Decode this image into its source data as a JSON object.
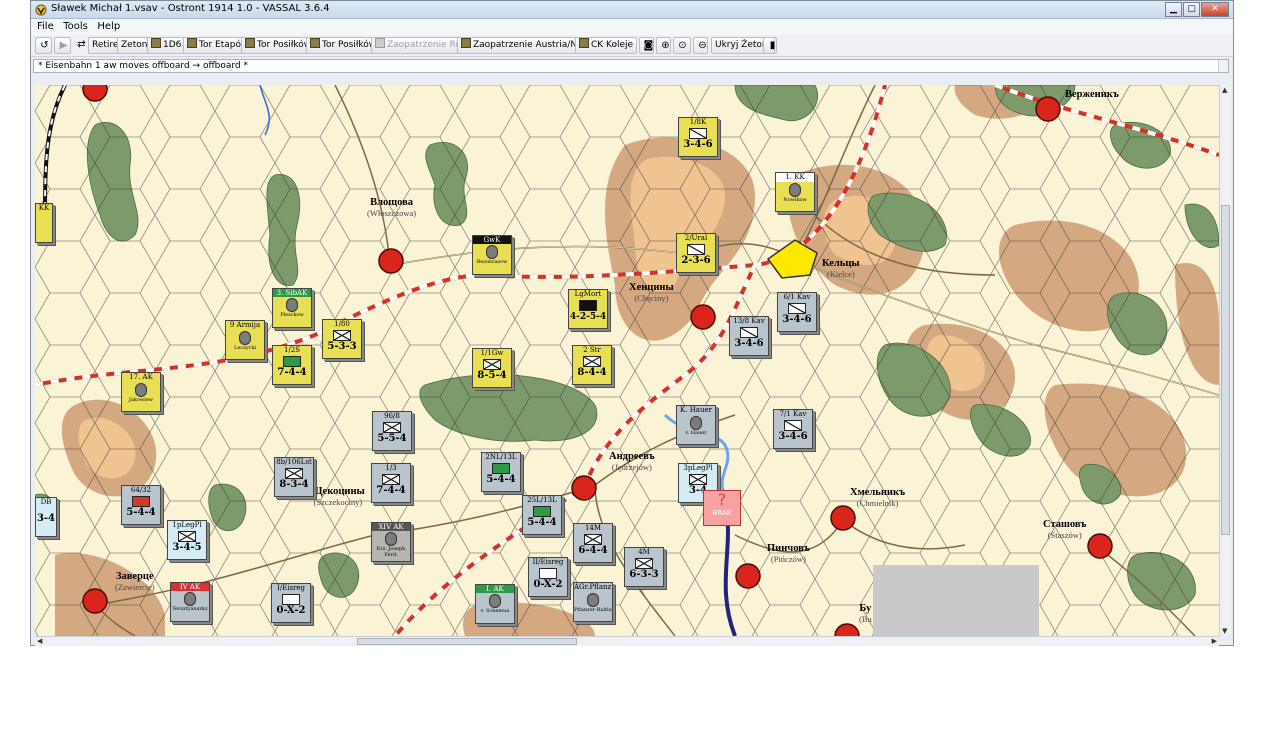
{
  "window": {
    "title": "Sławek Michał 1.vsav - Ostront 1914 1.0 - VASSAL 3.6.4",
    "controls": [
      "minimize-icon",
      "maximize-icon",
      "close-icon"
    ]
  },
  "menu": {
    "file": "File",
    "tools": "Tools",
    "help": "Help"
  },
  "toolbar": {
    "retire": "Retire",
    "zetony": "Zetony",
    "d6": "1D6",
    "tor_etapow": "Tor Etapów",
    "tor_posilkow_1": "Tor Posiłków",
    "tor_posilkow_2": "Tor Posiłków",
    "zaopatrzenie_rosja": "Zaopatrzenie Rosja",
    "zaopatrzenie_austria": "Zaopatrzenie Austria/Niemcy",
    "ck_koleje": "CK Koleje",
    "ukryj_zetony": "Ukryj Żetony"
  },
  "chat": {
    "line": "* Eisenbahn 1 aw moves offboard → offboard *"
  },
  "map": {
    "cities": [
      {
        "ru": "Влощова",
        "pl": "(Włoszczowa)"
      },
      {
        "ru": "Хенцины",
        "pl": "(Chęciny)"
      },
      {
        "ru": "Кельцы",
        "pl": "(Kielce)"
      },
      {
        "ru": "Верженикъ",
        "pl": ""
      },
      {
        "ru": "Андреевъ",
        "pl": "(Jędrzejów)"
      },
      {
        "ru": "Хмельникъ",
        "pl": "(Chmielnik)"
      },
      {
        "ru": "Сташовъ",
        "pl": "(Staszów)"
      },
      {
        "ru": "Пинчовъ",
        "pl": "(Pińczów)"
      },
      {
        "ru": "Заверце",
        "pl": "(Zawiercie)"
      },
      {
        "ru": "Щекоцины",
        "pl": "(Szczekociny)"
      },
      {
        "ru": "Бу",
        "pl": "(Bu"
      }
    ],
    "counters": [
      {
        "top": "1/8K",
        "val": "3-4-6",
        "color": "yellow",
        "sym": "cav"
      },
      {
        "top": "1. KK",
        "val": "Nowikow",
        "color": "yellow",
        "sym": "leader"
      },
      {
        "top": "GwK",
        "val": "Bezobrazow",
        "color": "yellow",
        "sym": "leader"
      },
      {
        "top": "2/Ural",
        "val": "2-3-6",
        "color": "yellow",
        "sym": "cav"
      },
      {
        "top": "LgMort",
        "val": "4-2-5-4",
        "color": "yellow",
        "sym": "art"
      },
      {
        "top": "6/1 Kav",
        "val": "3-4-6",
        "color": "grey",
        "sym": "cav"
      },
      {
        "top": "13/8 Kav",
        "val": "3-4-6",
        "color": "grey",
        "sym": "cav"
      },
      {
        "top": "1/1Gw",
        "val": "8-5-4",
        "color": "yellow",
        "sym": "inf"
      },
      {
        "top": "2 Str",
        "val": "8-4-4",
        "color": "yellow",
        "sym": "inf"
      },
      {
        "top": "K. Hauer",
        "val": "v. Hauer",
        "color": "grey",
        "sym": "leader"
      },
      {
        "top": "7/1 Kav",
        "val": "3-4-6",
        "color": "grey",
        "sym": "cav"
      },
      {
        "top": "9 Armija",
        "val": "Leczycki",
        "color": "yellow",
        "sym": "leader"
      },
      {
        "top": "1/80",
        "val": "5-3-3",
        "color": "yellow",
        "sym": "inf"
      },
      {
        "top": "1/2S",
        "val": "7-4-4",
        "color": "yellow",
        "sym": "inf"
      },
      {
        "top": "17. AK",
        "val": "Jakowlew",
        "color": "yellow",
        "sym": "leader"
      },
      {
        "top": "3. SibAK",
        "val": "Plesckow",
        "color": "yellow",
        "sym": "leader"
      },
      {
        "top": "96/8",
        "val": "5-5-4",
        "color": "grey",
        "sym": "inf"
      },
      {
        "top": "2NL/13L",
        "val": "5-4-4",
        "color": "grey",
        "sym": "inf"
      },
      {
        "top": "3pLegPl",
        "val": "3-4",
        "color": "blue",
        "sym": "inf"
      },
      {
        "top": "8b/106Lst",
        "val": "8-3-4",
        "color": "grey",
        "sym": "inf"
      },
      {
        "top": "1/3",
        "val": "7-4-4",
        "color": "grey",
        "sym": "inf"
      },
      {
        "top": "25L/13L",
        "val": "5-4-4",
        "color": "grey",
        "sym": "inf"
      },
      {
        "top": "64/32",
        "val": "5-4-4",
        "color": "grey",
        "sym": "inf"
      },
      {
        "top": "1pLegPl",
        "val": "3-4-5",
        "color": "blue",
        "sym": "inf"
      },
      {
        "top": "XIV AK",
        "val": "Erz. Joseph Ferd.",
        "color": "dgrey",
        "sym": "leader"
      },
      {
        "top": "14M",
        "val": "6-4-4",
        "color": "grey",
        "sym": "inf"
      },
      {
        "top": "4M",
        "val": "6-3-3",
        "color": "grey",
        "sym": "inf"
      },
      {
        "top": "II/Eisreg",
        "val": "0-X-2",
        "color": "grey",
        "sym": "rail"
      },
      {
        "top": "IV AK",
        "val": "Tersztyánszky",
        "color": "grey",
        "sym": "leader"
      },
      {
        "top": "I/Eisreg",
        "val": "0-X-2",
        "color": "grey",
        "sym": "rail"
      },
      {
        "top": "I. AK",
        "val": "v. Schemua",
        "color": "grey",
        "sym": "leader"
      },
      {
        "top": "AGr.Pflanz.",
        "val": "Pflanzer-Baltin",
        "color": "grey",
        "sym": "leader"
      },
      {
        "top": "DB",
        "val": "3-4",
        "color": "blue",
        "sym": "inf"
      },
      {
        "top": "KK",
        "val": "",
        "color": "yellow",
        "sym": "leader"
      }
    ],
    "marker": "BRAK"
  }
}
